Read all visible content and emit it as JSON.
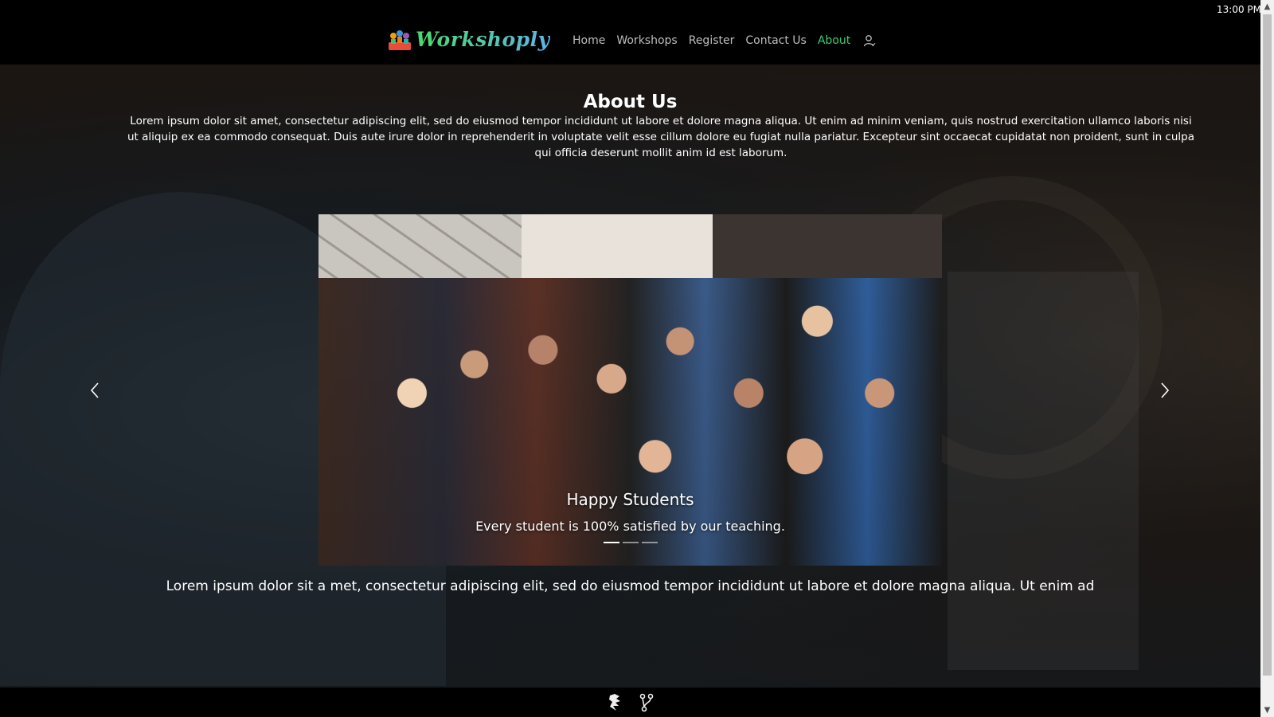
{
  "system": {
    "clock": "13:00 PM"
  },
  "brand": {
    "name": "Workshoply",
    "logo_icon": "workshop-people-logo"
  },
  "nav": {
    "items": [
      {
        "label": "Home",
        "active": false
      },
      {
        "label": "Workshops",
        "active": false
      },
      {
        "label": "Register",
        "active": false
      },
      {
        "label": "Contact Us",
        "active": false
      },
      {
        "label": "About",
        "active": true
      }
    ],
    "user_icon": "user-icon",
    "active_color": "#3ccf6e"
  },
  "about": {
    "title": "About Us",
    "text": "Lorem ipsum dolor sit amet, consectetur adipiscing elit, sed do eiusmod tempor incididunt ut labore et dolore magna aliqua. Ut enim ad minim veniam, quis nostrud exercitation ullamco laboris nisi ut aliquip ex ea commodo consequat. Duis aute irure dolor in reprehenderit in voluptate velit esse cillum dolore eu fugiat nulla pariatur. Excepteur sint occaecat cupidatat non proident, sunt in culpa qui officia deserunt mollit anim id est laborum."
  },
  "carousel": {
    "slide": {
      "title": "Happy Students",
      "subtitle": "Every student is 100% satisfied by our teaching."
    },
    "indicator_count": 3,
    "active_indicator": 0,
    "prev_icon": "chevron-left-icon",
    "next_icon": "chevron-right-icon"
  },
  "bottom": {
    "text": "Lorem ipsum dolor sit a met, consectetur adipiscing elit, sed do eiusmod tempor incididunt ut labore et dolore magna aliqua. Ut enim ad"
  },
  "footer": {
    "icons": [
      "dragon-icon",
      "fork-icon"
    ]
  }
}
